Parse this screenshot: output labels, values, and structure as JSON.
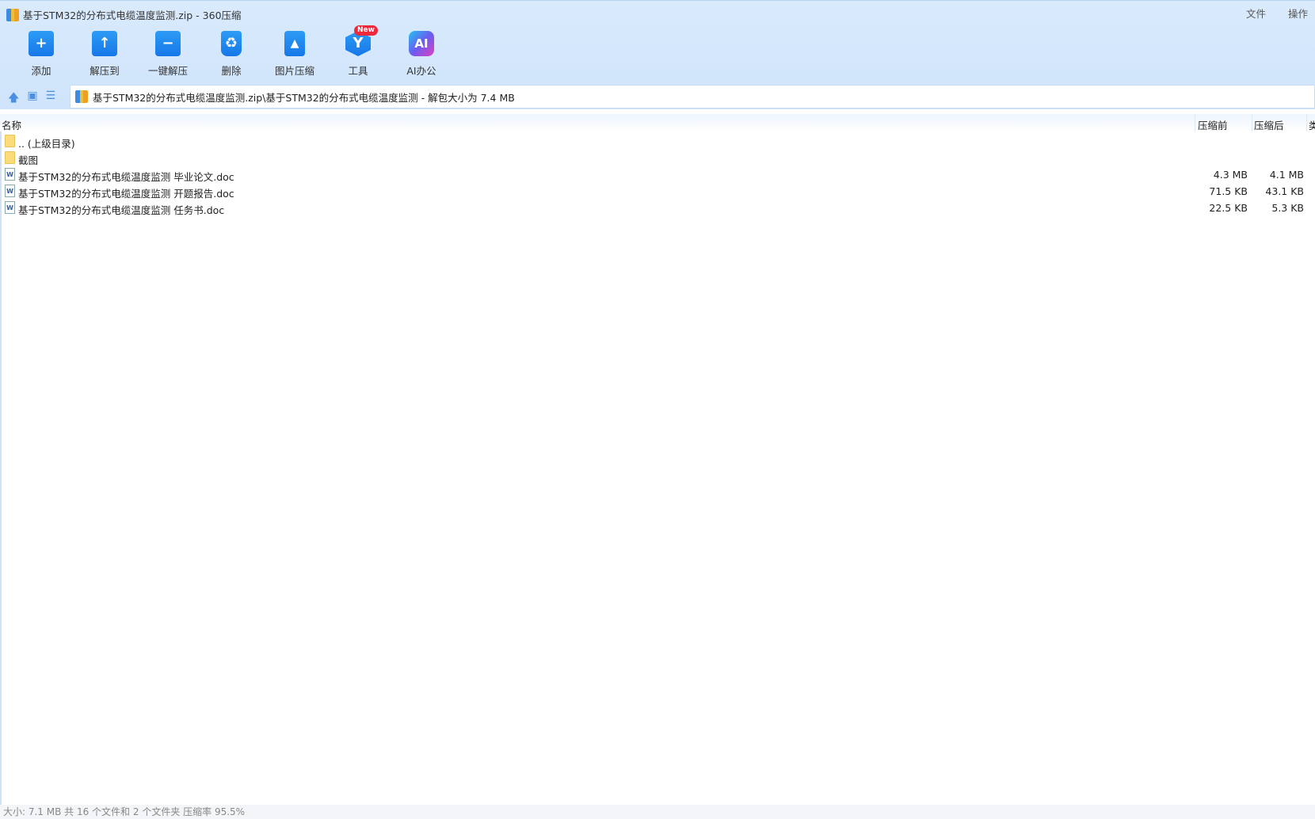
{
  "window": {
    "title": "基于STM32的分布式电缆温度监测.zip - 360压缩",
    "menu": [
      "文件",
      "操作"
    ]
  },
  "toolbar": [
    {
      "label": "添加",
      "icon": "+"
    },
    {
      "label": "解压到",
      "icon": "↑"
    },
    {
      "label": "一键解压",
      "icon": "−"
    },
    {
      "label": "删除",
      "icon": "♻"
    },
    {
      "label": "图片压缩",
      "icon": "▲"
    },
    {
      "label": "工具",
      "icon": "Y",
      "badge": "New"
    },
    {
      "label": "AI办公",
      "icon": "AI"
    }
  ],
  "address": {
    "path": "基于STM32的分布式电缆温度监测.zip\\基于STM32的分布式电缆温度监测 - 解包大小为 7.4 MB"
  },
  "columns": {
    "name": "名称",
    "before": "压缩前",
    "after": "压缩后",
    "type": "类"
  },
  "files": [
    {
      "name": ".. (上级目录)",
      "before": "",
      "after": ""
    },
    {
      "name": "截图",
      "before": "",
      "after": ""
    },
    {
      "name": "基于STM32的分布式电缆温度监测 毕业论文.doc",
      "before": "4.3 MB",
      "after": "4.1 MB"
    },
    {
      "name": "基于STM32的分布式电缆温度监测 开题报告.doc",
      "before": "71.5 KB",
      "after": "43.1 KB"
    },
    {
      "name": "基于STM32的分布式电缆温度监测 任务书.doc",
      "before": "22.5 KB",
      "after": "5.3 KB"
    }
  ],
  "status": "大小: 7.1 MB 共 16 个文件和 2 个文件夹 压缩率 95.5%"
}
